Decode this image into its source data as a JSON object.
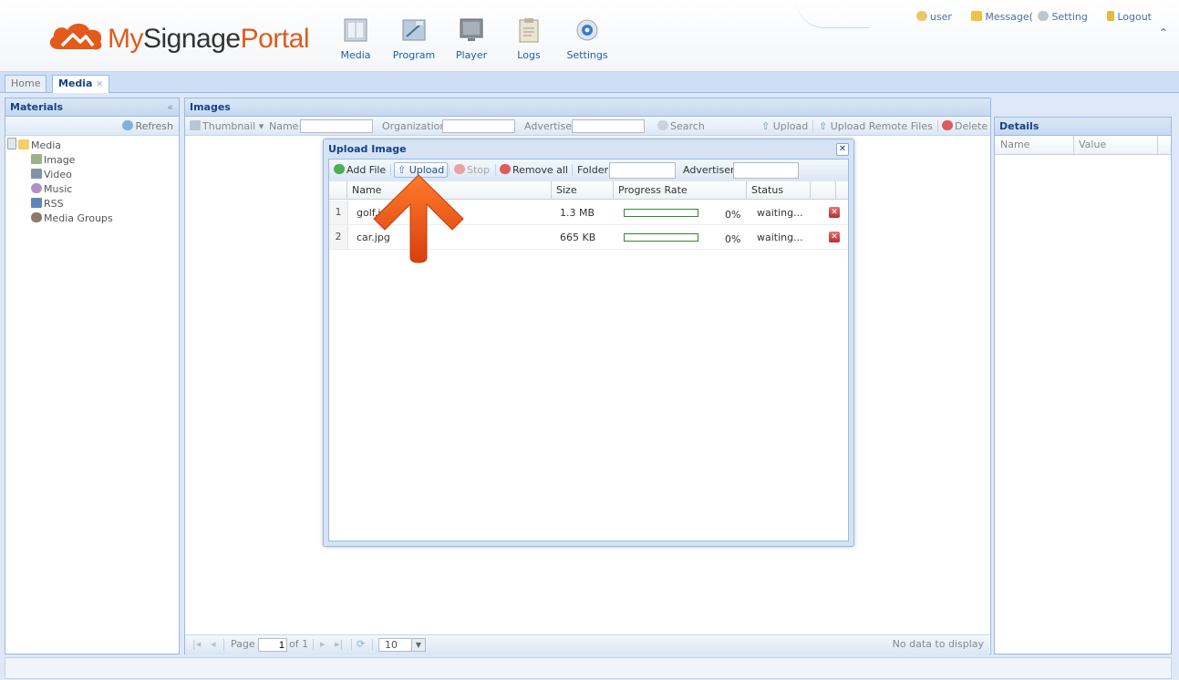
{
  "header": {
    "logo": {
      "word1": "My",
      "word2": "Signage",
      "word3": "Portal"
    },
    "nav": [
      {
        "label": "Media",
        "icon": "media-icon"
      },
      {
        "label": "Program",
        "icon": "program-icon"
      },
      {
        "label": "Player",
        "icon": "player-icon"
      },
      {
        "label": "Logs",
        "icon": "logs-icon"
      },
      {
        "label": "Settings",
        "icon": "settings-icon"
      }
    ],
    "user_links": {
      "user": "user",
      "message": "Message(",
      "setting": "Setting",
      "logout": "Logout"
    }
  },
  "tabs": [
    {
      "label": "Home",
      "active": false
    },
    {
      "label": "Media",
      "active": true
    }
  ],
  "materials": {
    "title": "Materials",
    "refresh": "Refresh",
    "tree": {
      "root": "Media",
      "children": [
        "Image",
        "Video",
        "Music",
        "RSS",
        "Media Groups"
      ]
    }
  },
  "images": {
    "title": "Images",
    "toolbar": {
      "view": "Thumbnail",
      "name_label": "Name:",
      "organization_label": "Organization:",
      "advertiser_label": "Advertiser:",
      "search": "Search",
      "upload": "Upload",
      "upload_remote": "Upload Remote Files",
      "delete": "Delete"
    },
    "paging": {
      "page_label": "Page",
      "page_value": "1",
      "of": "of 1",
      "page_size": "10",
      "empty": "No data to display"
    }
  },
  "details": {
    "title": "Details",
    "columns": [
      "Name",
      "Value"
    ]
  },
  "dialog": {
    "title": "Upload Image",
    "toolbar": {
      "add_file": "Add File",
      "upload": "Upload",
      "stop": "Stop",
      "remove_all": "Remove all",
      "folder_label": "Folder:",
      "advertiser_label": "Advertiser:"
    },
    "columns": [
      "Name",
      "Size",
      "Progress Rate",
      "Status"
    ],
    "rows": [
      {
        "num": "1",
        "name": "golf.j",
        "size": "1.3 MB",
        "progress": 0,
        "progress_text": "0%",
        "status": "waiting..."
      },
      {
        "num": "2",
        "name": "car.jpg",
        "size": "665 KB",
        "progress": 0,
        "progress_text": "0%",
        "status": "waiting..."
      }
    ]
  },
  "colors": {
    "brand_orange": "#e35a1a",
    "nav_blue": "#1f5faa",
    "panel_title": "#15428b",
    "arrow": "#e04a12"
  }
}
